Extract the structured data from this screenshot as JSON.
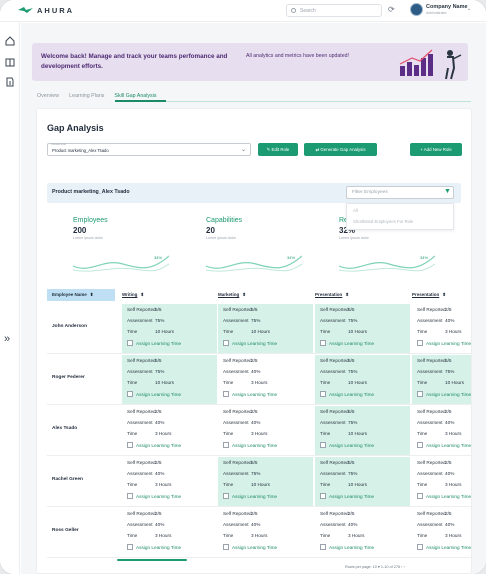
{
  "app": {
    "brand": "AHURA"
  },
  "topbar": {
    "search_placeholder": "Search",
    "company_name": "Company Name",
    "company_sub": "Administrator"
  },
  "banner": {
    "title": "Welcome back! Manage and track your teams perfomance and development efforts.",
    "note": "All analytics and metrics have been updated!"
  },
  "tabs": [
    {
      "label": "Overview"
    },
    {
      "label": "Learning Plans"
    },
    {
      "label": "Skill Gap Analysis"
    }
  ],
  "gap": {
    "title": "Gap Analysis",
    "select_label": "Choose Role",
    "select_value": "Product marketing_Alex Tsado",
    "edit_role": "Edit Role",
    "generate": "Generate Gap Analysis",
    "add_role": "+ Add New Role",
    "filter_title": "Product marketing_Alex Tsado",
    "filter_placeholder": "Filter Employees",
    "filter_options": [
      "All",
      "Shortlisted Employees For Role"
    ]
  },
  "stats": [
    {
      "label": "Employees",
      "value": "200",
      "sub": "Lorem ipsum dolor",
      "pct": "34%"
    },
    {
      "label": "Capabilities",
      "value": "20",
      "sub": "Lorem ipsum dolor",
      "pct": "34%"
    },
    {
      "label": "Re",
      "value": "32%",
      "sub": "Lorem ipsum dolor",
      "pct": "34%"
    }
  ],
  "table": {
    "columns": [
      "Employee Name",
      "Writing",
      "Marketing",
      "Presentation",
      "Presentation"
    ],
    "labels": {
      "self": "Self Reported",
      "assessment": "Assessment",
      "time": "Time",
      "assign": "Assign Learning Time"
    },
    "rows": [
      {
        "name": "John Anderson",
        "cells": [
          {
            "self": "5/5",
            "assessment": "75%",
            "time": "10 Hours",
            "green": true
          },
          {
            "self": "5/5",
            "assessment": "75%",
            "time": "10 Hours",
            "green": true
          },
          {
            "self": "5/5",
            "assessment": "75%",
            "time": "10 Hours",
            "green": true
          },
          {
            "self": "2/5",
            "assessment": "40%",
            "time": "3 Hours",
            "green": false
          }
        ]
      },
      {
        "name": "Roger Federer",
        "cells": [
          {
            "self": "5/5",
            "assessment": "75%",
            "time": "10 Hours",
            "green": true
          },
          {
            "self": "2/5",
            "assessment": "40%",
            "time": "3 Hours",
            "green": false
          },
          {
            "self": "5/5",
            "assessment": "75%",
            "time": "10 Hours",
            "green": true
          },
          {
            "self": "5/5",
            "assessment": "75%",
            "time": "10 Hours",
            "green": true
          }
        ]
      },
      {
        "name": "Alex Tsado",
        "cells": [
          {
            "self": "2/5",
            "assessment": "40%",
            "time": "3 Hours",
            "green": false
          },
          {
            "self": "2/5",
            "assessment": "40%",
            "time": "3 Hours",
            "green": false
          },
          {
            "self": "5/5",
            "assessment": "75%",
            "time": "10 Hours",
            "green": true
          },
          {
            "self": "2/5",
            "assessment": "40%",
            "time": "3 Hours",
            "green": false
          }
        ]
      },
      {
        "name": "Rachel Green",
        "cells": [
          {
            "self": "2/5",
            "assessment": "40%",
            "time": "3 Hours",
            "green": false
          },
          {
            "self": "5/5",
            "assessment": "75%",
            "time": "10 Hours",
            "green": true
          },
          {
            "self": "5/5",
            "assessment": "75%",
            "time": "10 Hours",
            "green": true
          },
          {
            "self": "2/5",
            "assessment": "40%",
            "time": "3 Hours",
            "green": false
          }
        ]
      },
      {
        "name": "Ross Geller",
        "cells": [
          {
            "self": "2/5",
            "assessment": "40%",
            "time": "3 Hours",
            "green": false
          },
          {
            "self": "2/5",
            "assessment": "40%",
            "time": "3 Hours",
            "green": false
          },
          {
            "self": "2/5",
            "assessment": "40%",
            "time": "3 Hours",
            "green": false
          },
          {
            "self": "2/5",
            "assessment": "40%",
            "time": "3 Hours",
            "green": false
          }
        ]
      }
    ]
  },
  "pager": {
    "text": "Rows per page: 10 ▾   1-10 of 276   ‹  ›"
  },
  "colors": {
    "accent": "#1c9a72",
    "banner": "#e7dff0",
    "cell_green": "#d6f1e8"
  }
}
